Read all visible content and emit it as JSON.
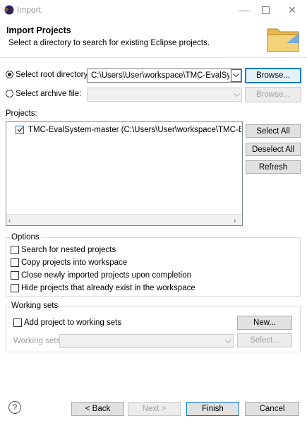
{
  "window": {
    "title": "Import",
    "minimize_icon": "minimize-icon",
    "maximize_icon": "maximize-icon",
    "close_icon": "close-icon"
  },
  "header": {
    "title": "Import Projects",
    "subtitle": "Select a directory to search for existing Eclipse projects.",
    "banner_icon": "folder-icon"
  },
  "source": {
    "root_label": "Select root directory:",
    "root_value": "C:\\Users\\User\\workspace\\TMC-EvalSystem-",
    "root_selected": true,
    "archive_label": "Select archive file:",
    "archive_value": "",
    "archive_selected": false,
    "browse_label": "Browse...",
    "browse2_label": "Browse..."
  },
  "projects": {
    "label": "Projects:",
    "items": [
      {
        "text": "TMC-EvalSystem-master (C:\\Users\\User\\workspace\\TMC-EvalSyste",
        "checked": true
      }
    ],
    "select_all": "Select All",
    "deselect_all": "Deselect All",
    "refresh": "Refresh"
  },
  "options": {
    "title": "Options",
    "items": [
      {
        "label": "Search for nested projects",
        "checked": false
      },
      {
        "label": "Copy projects into workspace",
        "checked": false
      },
      {
        "label": "Close newly imported projects upon completion",
        "checked": false
      },
      {
        "label": "Hide projects that already exist in the workspace",
        "checked": false
      }
    ]
  },
  "working_sets": {
    "title": "Working sets",
    "add_label": "Add project to working sets",
    "add_checked": false,
    "new_label": "New...",
    "sets_label": "Working sets:",
    "sets_value": "",
    "select_label": "Select..."
  },
  "footer": {
    "help_icon": "help-icon",
    "back": "< Back",
    "next": "Next >",
    "finish": "Finish",
    "cancel": "Cancel"
  }
}
